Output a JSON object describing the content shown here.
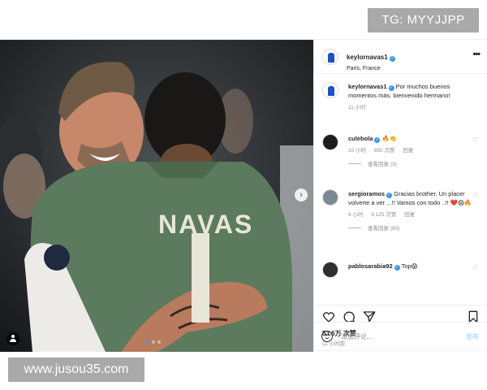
{
  "watermarks": {
    "top": "TG: MYYJJPP",
    "bottom": "www.jusou35.com"
  },
  "photo": {
    "jersey_text": "NAVAS",
    "jersey_number": "1"
  },
  "header": {
    "username": "keylornavas1",
    "location": "Paris, France",
    "more_icon": "more-horizontal-icon"
  },
  "caption": {
    "username": "keylornavas1",
    "text": "Por muchos buenos momentos más. bienvenido hermano!",
    "time": "11 小时"
  },
  "comments": [
    {
      "username": "culebola",
      "text": "🔥👏",
      "time": "10 小时",
      "likes": "650 次赞",
      "reply": "回复",
      "view_replies": "查看回复 (3)"
    },
    {
      "username": "sergioramos",
      "text": "Gracias brother. Un placer volverte a ver ...!! Vamos con todo ..!! ❤️😱🔥",
      "time": "9 小时",
      "likes": "9,125 次赞",
      "reply": "回复",
      "view_replies": "查看回复 (80)"
    },
    {
      "username": "pablosarabia92",
      "text": "Top😱",
      "time": "",
      "likes": "",
      "reply": "",
      "view_replies": ""
    }
  ],
  "actions": {
    "likes": "53.6万 次赞",
    "time": "11 小时前"
  },
  "add_comment": {
    "placeholder": "添加评论...",
    "post_label": "发布"
  },
  "colors": {
    "verified": "#3897f0",
    "jersey": "#5c7a5d",
    "link_disabled": "#b3dbff"
  }
}
